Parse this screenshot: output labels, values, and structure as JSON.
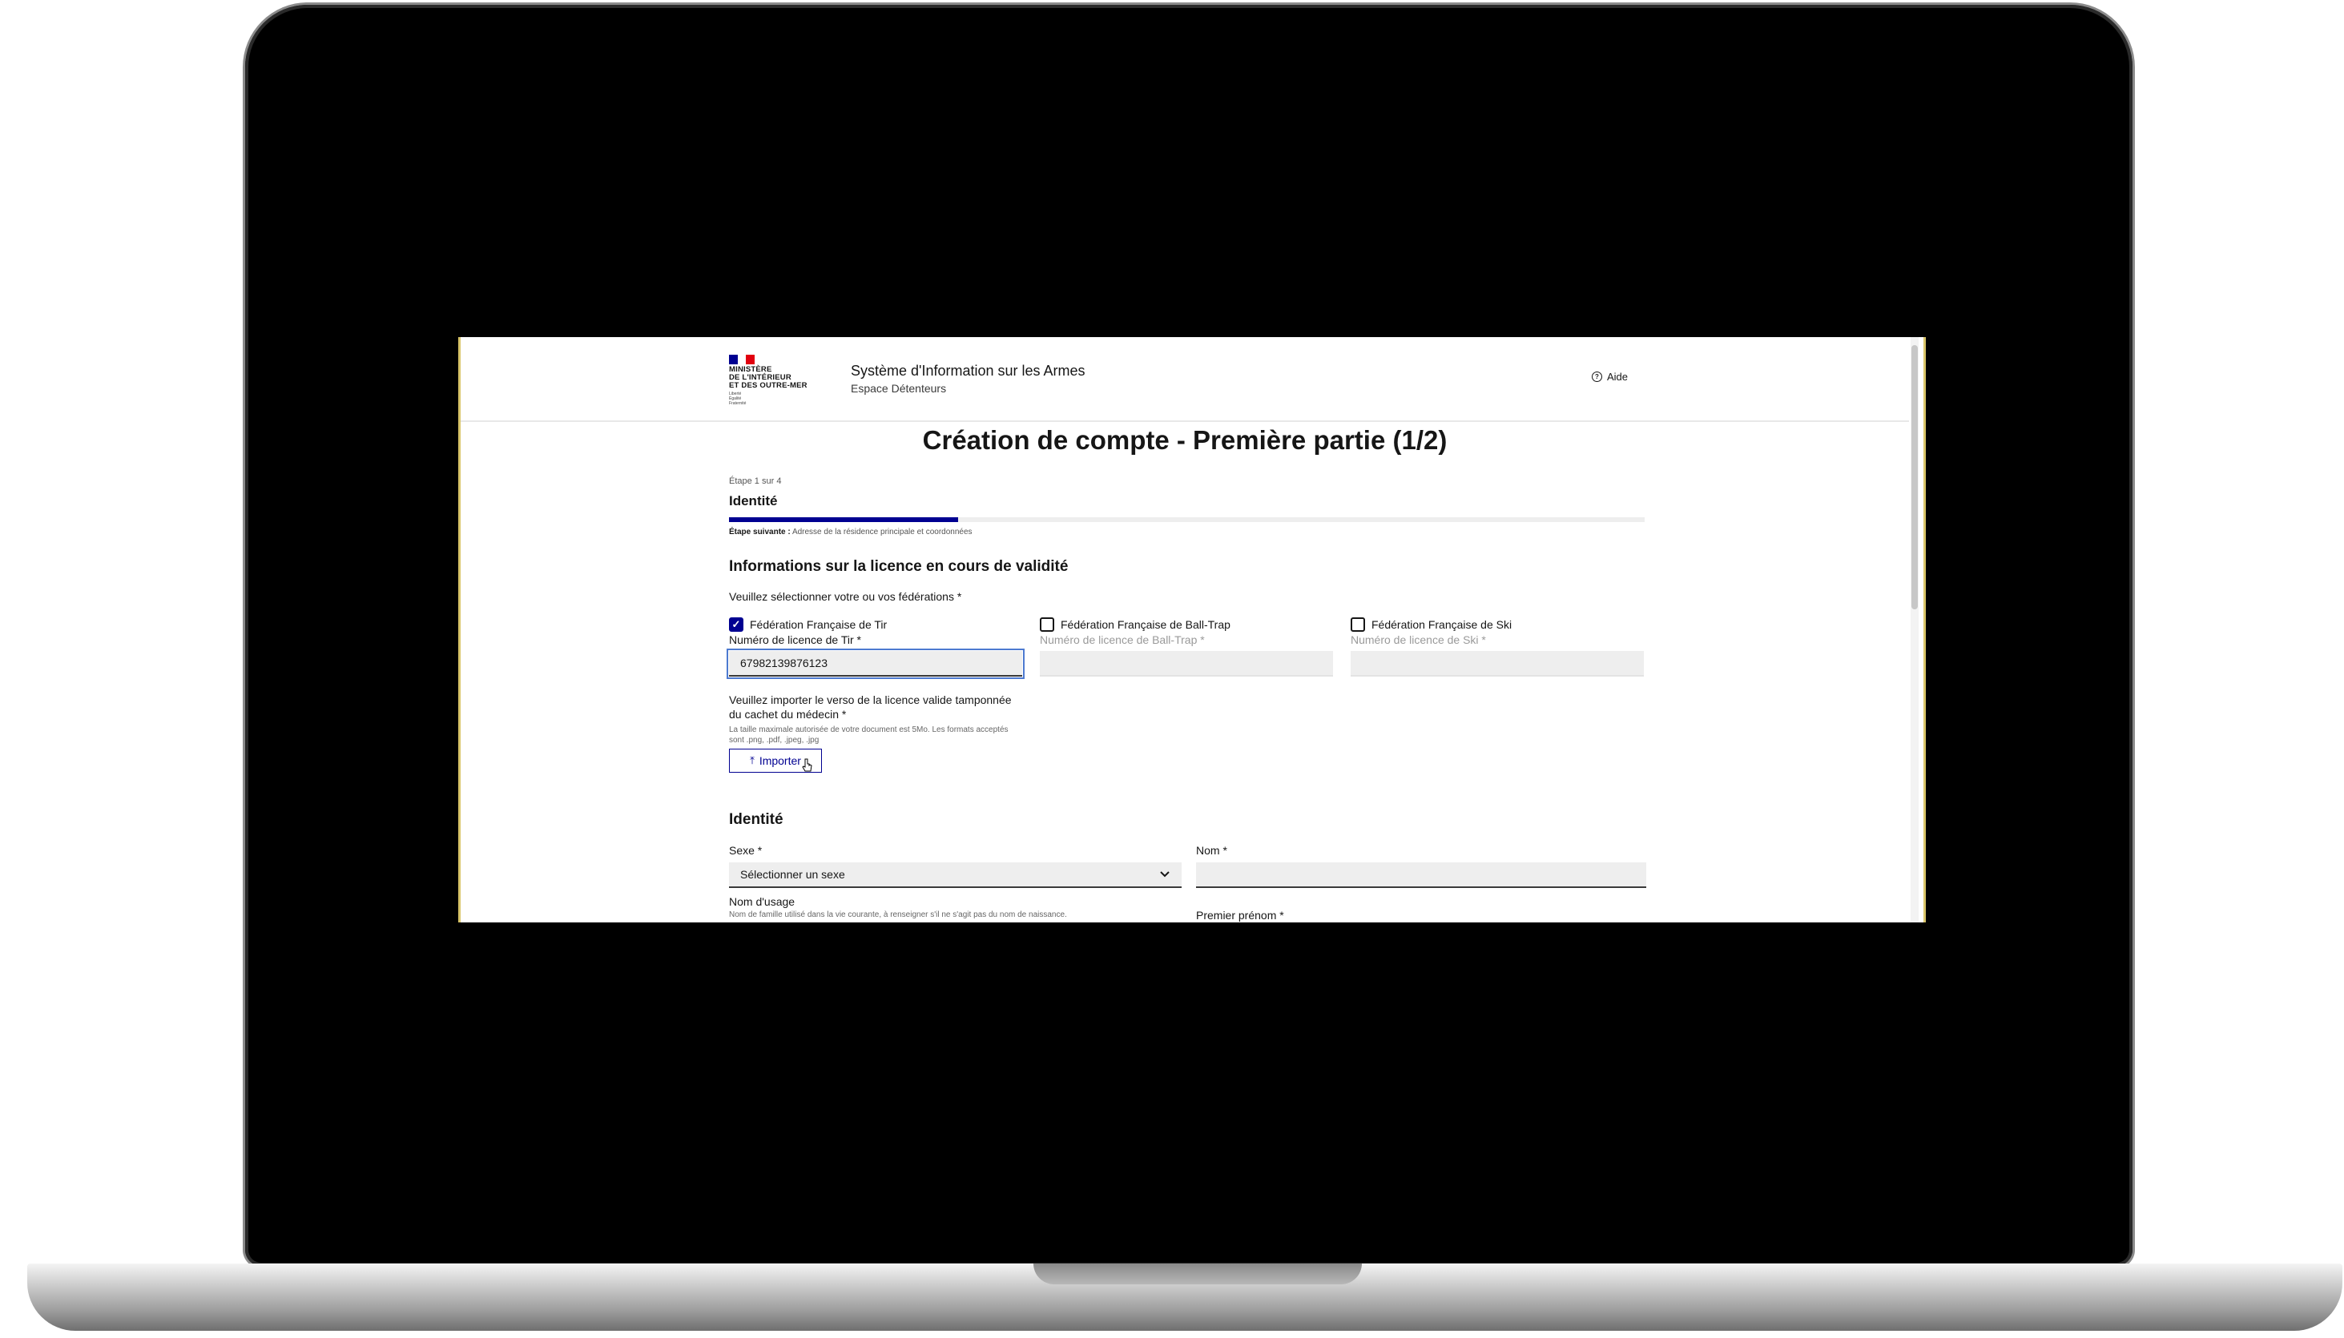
{
  "header": {
    "ministry_lines": "MINISTÈRE\nDE L'INTÉRIEUR\nET DES OUTRE-MER",
    "motto": "Liberté\nÉgalité\nFraternité",
    "site_title": "Système d'Information sur les Armes",
    "site_subtitle": "Espace Détenteurs",
    "help_label": "Aide"
  },
  "page": {
    "title": "Création de compte - Première partie (1/2)"
  },
  "stepper": {
    "step_label": "Étape 1 sur 4",
    "step_title": "Identité",
    "progress": 0.25,
    "next_label": "Étape suivante :",
    "next_value": "Adresse de la résidence principale et coordonnées"
  },
  "licence_section": {
    "title": "Informations sur la licence en cours de validité",
    "legend": "Veuillez sélectionner votre ou vos fédérations *",
    "federations": [
      {
        "name": "Fédération Française de Tir",
        "checked": true,
        "field_label": "Numéro de licence de Tir *",
        "value": "67982139876123"
      },
      {
        "name": "Fédération Française de Ball-Trap",
        "checked": false,
        "field_label": "Numéro de licence de Ball-Trap *",
        "value": ""
      },
      {
        "name": "Fédération Française de Ski",
        "checked": false,
        "field_label": "Numéro de licence de Ski *",
        "value": ""
      }
    ],
    "upload_title": "Veuillez importer le verso de la licence valide tamponnée du cachet du médecin *",
    "upload_hint": "La taille maximale autorisée de votre document est 5Mo. Les formats acceptés sont .png, .pdf, .jpeg, .jpg",
    "import_label": "Importer"
  },
  "identity_section": {
    "title": "Identité",
    "sexe_label": "Sexe *",
    "sexe_value": "Sélectionner un sexe",
    "nom_label": "Nom *",
    "nom_usage_label": "Nom d'usage",
    "nom_usage_hint": "Nom de famille utilisé dans la vie courante, à renseigner s'il ne s'agit pas du nom de naissance.",
    "prenom_label": "Premier prénom *"
  },
  "colors": {
    "accent": "#000091",
    "flag_blue": "#000091",
    "flag_red": "#e1000f"
  }
}
